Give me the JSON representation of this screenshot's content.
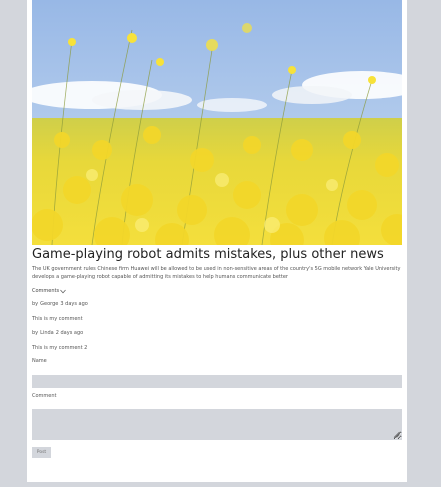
{
  "article": {
    "title": "Game-playing robot admits mistakes, plus other news",
    "summary": "The UK government rules Chinese firm Huawei will be allowed to be used in non-sensitive areas of the country's 5G mobile network Yale University develops a game-playing robot capable of admitting its mistakes to help humans communicate better",
    "image_icon": "rapeseed-field-photo"
  },
  "comments": {
    "toggle_label": "Comments",
    "toggle_icon": "chevron-down-icon",
    "items": [
      {
        "by": "by",
        "author": "George",
        "time": "3 days ago",
        "text": "This is my comment"
      },
      {
        "by": "by",
        "author": "Linda",
        "time": "2 days ago",
        "text": "This is my comment 2"
      }
    ]
  },
  "form": {
    "name_label": "Name",
    "name_value": "",
    "comment_label": "Comment",
    "comment_value": "",
    "post_label": "Post"
  },
  "colors": {
    "page_bg": "#d3d6dc",
    "card_bg": "#ffffff",
    "input_bg": "#d3d6dc",
    "sky": "#a9c6ec",
    "flowers": "#f1dd3b"
  }
}
